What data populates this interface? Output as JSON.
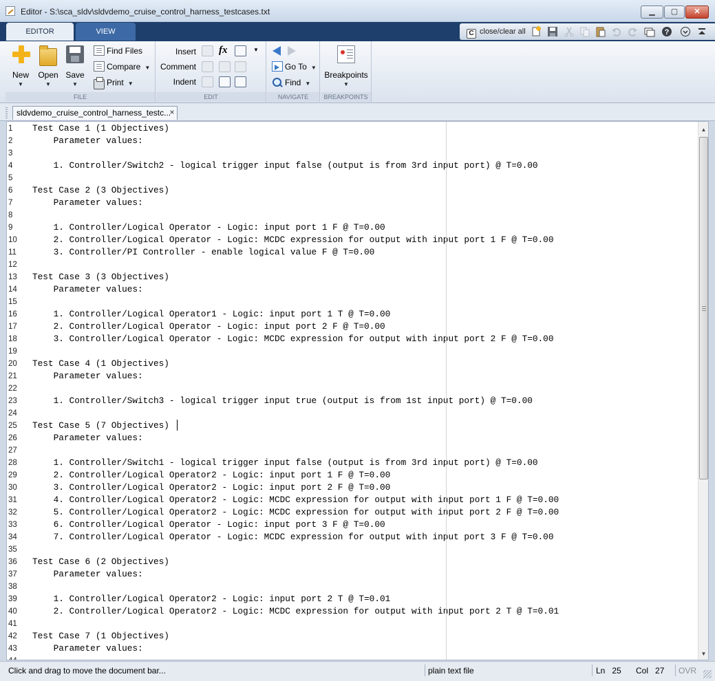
{
  "window": {
    "title": "Editor - S:\\sca_sldv\\sldvdemo_cruise_control_harness_testcases.txt"
  },
  "tabs": [
    {
      "label": "EDITOR",
      "active": true
    },
    {
      "label": "VIEW",
      "active": false
    }
  ],
  "quick_access": {
    "close_clear_label": "close/clear all",
    "c_glyph": "C"
  },
  "ribbon": {
    "file": {
      "label": "FILE",
      "new_label": "New",
      "open_label": "Open",
      "save_label": "Save",
      "find_files_label": "Find Files",
      "compare_label": "Compare",
      "print_label": "Print"
    },
    "edit": {
      "label": "EDIT",
      "insert_label": "Insert",
      "comment_label": "Comment",
      "indent_label": "Indent",
      "fx_glyph": "fx"
    },
    "navigate": {
      "label": "NAVIGATE",
      "goto_label": "Go To",
      "find_label": "Find"
    },
    "breakpoints": {
      "label": "BREAKPOINTS",
      "breakpoints_label": "Breakpoints"
    }
  },
  "document_tab": {
    "label": "sldvdemo_cruise_control_harness_testc...",
    "close_glyph": "×"
  },
  "editor": {
    "lines": [
      "Test Case 1 (1 Objectives)",
      "    Parameter values:",
      "",
      "    1. Controller/Switch2 - logical trigger input false (output is from 3rd input port) @ T=0.00",
      "",
      "Test Case 2 (3 Objectives)",
      "    Parameter values:",
      "",
      "    1. Controller/Logical Operator - Logic: input port 1 F @ T=0.00",
      "    2. Controller/Logical Operator - Logic: MCDC expression for output with input port 1 F @ T=0.00",
      "    3. Controller/PI Controller - enable logical value F @ T=0.00",
      "",
      "Test Case 3 (3 Objectives)",
      "    Parameter values:",
      "",
      "    1. Controller/Logical Operator1 - Logic: input port 1 T @ T=0.00",
      "    2. Controller/Logical Operator - Logic: input port 2 F @ T=0.00",
      "    3. Controller/Logical Operator - Logic: MCDC expression for output with input port 2 F @ T=0.00",
      "",
      "Test Case 4 (1 Objectives)",
      "    Parameter values:",
      "",
      "    1. Controller/Switch3 - logical trigger input true (output is from 1st input port) @ T=0.00",
      "",
      "Test Case 5 (7 Objectives)",
      "    Parameter values:",
      "",
      "    1. Controller/Switch1 - logical trigger input false (output is from 3rd input port) @ T=0.00",
      "    2. Controller/Logical Operator2 - Logic: input port 1 F @ T=0.00",
      "    3. Controller/Logical Operator2 - Logic: input port 2 F @ T=0.00",
      "    4. Controller/Logical Operator2 - Logic: MCDC expression for output with input port 1 F @ T=0.00",
      "    5. Controller/Logical Operator2 - Logic: MCDC expression for output with input port 2 F @ T=0.00",
      "    6. Controller/Logical Operator - Logic: input port 3 F @ T=0.00",
      "    7. Controller/Logical Operator - Logic: MCDC expression for output with input port 3 F @ T=0.00",
      "",
      "Test Case 6 (2 Objectives)",
      "    Parameter values:",
      "",
      "    1. Controller/Logical Operator2 - Logic: input port 2 T @ T=0.01",
      "    2. Controller/Logical Operator2 - Logic: MCDC expression for output with input port 2 T @ T=0.01",
      "",
      "Test Case 7 (1 Objectives)",
      "    Parameter values:",
      ""
    ]
  },
  "status": {
    "message": "Click and drag to move the document bar...",
    "file_type": "plain text file",
    "ln_label": "Ln",
    "ln_value": "25",
    "col_label": "Col",
    "col_value": "27",
    "ovr": "OVR"
  },
  "colors": {
    "tab_strip": "#1e3f6c",
    "accent": "#3a78c9"
  }
}
